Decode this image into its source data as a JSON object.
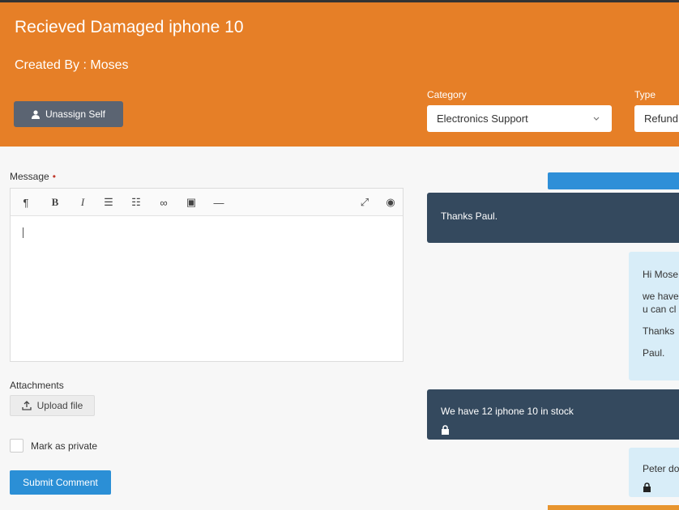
{
  "ticket": {
    "title": "Recieved Damaged iphone 10",
    "created_by": "Created By : Moses",
    "unassign_label": "Unassign Self",
    "category": {
      "label": "Category",
      "value": "Electronics Support"
    },
    "type": {
      "label": "Type",
      "value": "Refund"
    }
  },
  "comment_form": {
    "message_label": "Message",
    "required_marker": "•",
    "attachments_label": "Attachments",
    "upload_label": "Upload file",
    "private_label": "Mark as private",
    "submit_label": "Submit Comment"
  },
  "editor_toolbar": [
    {
      "name": "paragraph-icon",
      "glyph": "¶"
    },
    {
      "name": "bold-icon",
      "glyph": "B"
    },
    {
      "name": "italic-icon",
      "glyph": "I"
    },
    {
      "name": "bullet-list-icon",
      "glyph": "☰"
    },
    {
      "name": "numbered-list-icon",
      "glyph": "☷"
    },
    {
      "name": "link-icon",
      "glyph": "∞"
    },
    {
      "name": "image-icon",
      "glyph": "▣"
    },
    {
      "name": "horizontal-rule-icon",
      "glyph": "—"
    },
    {
      "name": "fullscreen-icon",
      "glyph": "⤢"
    },
    {
      "name": "preview-icon",
      "glyph": "◉"
    }
  ],
  "conversation": [
    {
      "side": "dark",
      "lines": [
        "Thanks Paul."
      ],
      "private": false
    },
    {
      "side": "light",
      "lines": [
        "Hi Mose",
        "we have",
        "u can cl",
        "Thanks",
        "Paul."
      ],
      "private": false
    },
    {
      "side": "dark",
      "lines": [
        "We have 12 iphone 10 in stock"
      ],
      "private": true
    },
    {
      "side": "light",
      "lines": [
        "Peter do"
      ],
      "private": true
    }
  ],
  "colors": {
    "header_orange": "#e67f27",
    "button_gray": "#5b6472",
    "submit_blue": "#2b8fd6",
    "dark_bubble": "#34495e",
    "light_bubble": "#d8edf8",
    "required_red": "#c0392b"
  }
}
